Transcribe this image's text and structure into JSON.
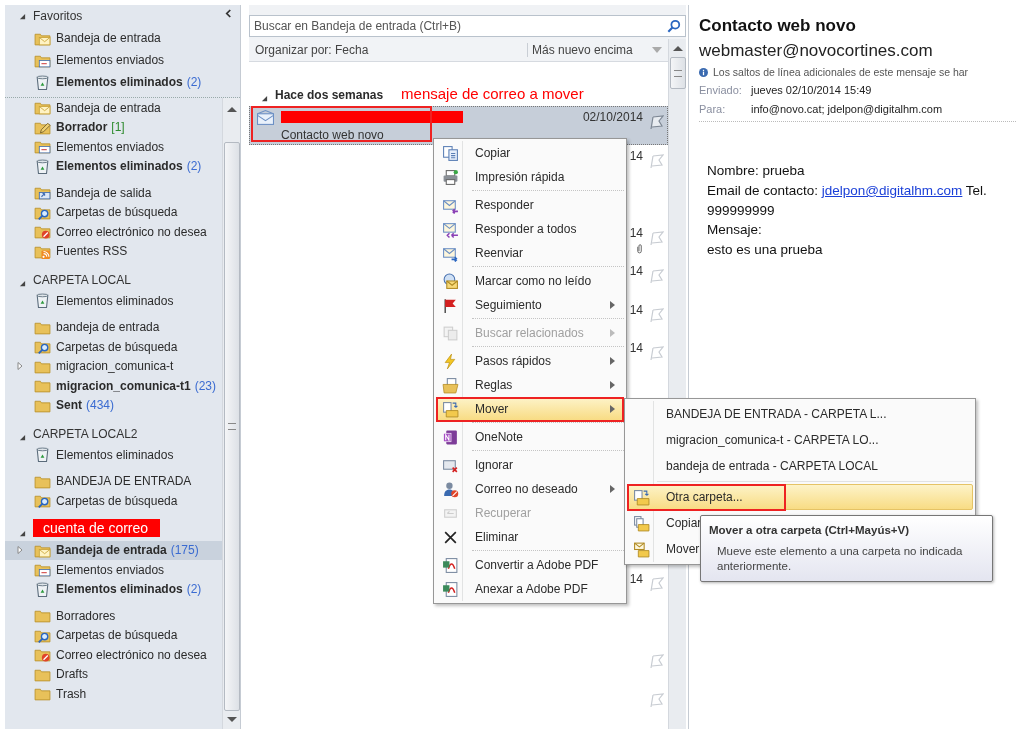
{
  "sidebar": {
    "favorites": {
      "title": "Favoritos",
      "expanded": true,
      "items": [
        {
          "name": "Bandeja de entrada",
          "kind": "inbox",
          "bold": false,
          "selected": false,
          "expandable": false
        },
        {
          "name": "Elementos enviados",
          "kind": "sent",
          "bold": false,
          "selected": false,
          "expandable": false
        },
        {
          "name": "Elementos eliminados",
          "kind": "deleted",
          "bold": true,
          "count": "(2)",
          "selected": false,
          "expandable": false
        }
      ]
    },
    "sections": [
      {
        "items": [
          {
            "name": "Bandeja de entrada",
            "kind": "inbox",
            "bold": false,
            "selected": false,
            "expandable": false
          },
          {
            "name": "Borrador",
            "kind": "drafts",
            "bold": true,
            "count": "[1]",
            "selected": false,
            "expandable": false
          },
          {
            "name": "Elementos enviados",
            "kind": "sent",
            "bold": false,
            "selected": false,
            "expandable": false
          },
          {
            "name": "Elementos eliminados",
            "kind": "deleted",
            "bold": true,
            "count": "(2)",
            "selected": false,
            "expandable": false
          },
          {
            "name": "Bandeja de salida",
            "kind": "outbox",
            "bold": false,
            "selected": false,
            "expandable": false
          },
          {
            "name": "Carpetas de búsqueda",
            "kind": "search",
            "bold": false,
            "selected": false,
            "expandable": false
          },
          {
            "name": "Correo electrónico no desea",
            "kind": "junk",
            "bold": false,
            "selected": false,
            "expandable": false
          },
          {
            "name": "Fuentes RSS",
            "kind": "rss",
            "bold": false,
            "selected": false,
            "expandable": false
          }
        ]
      },
      {
        "header": "CARPETA LOCAL",
        "kind": "plain",
        "expanded": true,
        "items": [
          {
            "name": "Elementos eliminados",
            "kind": "deleted",
            "bold": false,
            "selected": false,
            "expandable": false
          },
          {
            "name": "bandeja de entrada",
            "kind": "folder",
            "bold": false,
            "selected": false,
            "expandable": false
          },
          {
            "name": "Carpetas de búsqueda",
            "kind": "search",
            "bold": false,
            "selected": false,
            "expandable": false
          },
          {
            "name": "migracion_comunica-t",
            "kind": "folder",
            "bold": false,
            "selected": false,
            "expandable": true
          },
          {
            "name": "migracion_comunica-t1",
            "kind": "folder",
            "bold": true,
            "count": "(23)",
            "selected": false,
            "expandable": false
          },
          {
            "name": "Sent",
            "kind": "folder",
            "bold": true,
            "count": "(434)",
            "selected": false,
            "expandable": false
          }
        ]
      },
      {
        "header": "CARPETA LOCAL2",
        "kind": "plain",
        "expanded": true,
        "items": [
          {
            "name": "Elementos eliminados",
            "kind": "deleted",
            "bold": false,
            "selected": false,
            "expandable": false
          },
          {
            "name": "BANDEJA DE ENTRADA",
            "kind": "folder",
            "bold": false,
            "selected": false,
            "expandable": false
          },
          {
            "name": "Carpetas de búsqueda",
            "kind": "search",
            "bold": false,
            "selected": false,
            "expandable": false
          }
        ]
      },
      {
        "header": "cuenta de correo",
        "kind": "annotation",
        "expanded": true,
        "items": [
          {
            "name": "Bandeja de entrada",
            "kind": "inbox",
            "bold": true,
            "count": "(175)",
            "selected": true,
            "expandable": true
          },
          {
            "name": "Elementos enviados",
            "kind": "sent",
            "bold": false,
            "selected": false,
            "expandable": false
          },
          {
            "name": "Elementos eliminados",
            "kind": "deleted",
            "bold": true,
            "count": "(2)",
            "selected": false,
            "expandable": false
          },
          {
            "name": "Borradores",
            "kind": "folder",
            "bold": false,
            "selected": false,
            "expandable": false
          },
          {
            "name": "Carpetas de búsqueda",
            "kind": "search",
            "bold": false,
            "selected": false,
            "expandable": false
          },
          {
            "name": "Correo electrónico no desea",
            "kind": "junk",
            "bold": false,
            "selected": false,
            "expandable": false
          },
          {
            "name": "Drafts",
            "kind": "folder",
            "bold": false,
            "selected": false,
            "expandable": false
          },
          {
            "name": "Trash",
            "kind": "folder",
            "bold": false,
            "selected": false,
            "expandable": false
          }
        ]
      }
    ]
  },
  "search": {
    "placeholder": "Buscar en Bandeja de entrada (Ctrl+B)"
  },
  "arrange": {
    "label": "Organizar por: Fecha",
    "order": "Más nuevo encima"
  },
  "group": {
    "title": "Hace dos semanas",
    "expanded": true,
    "annotation": "mensaje de correo a mover"
  },
  "messages": [
    {
      "kind": "message",
      "subject": "Contacto web novo",
      "date": "02/10/2014",
      "redacted": true,
      "annotated": true,
      "selected": true,
      "attachment": false
    },
    {
      "kind": "message",
      "date": "14",
      "selected": false,
      "attachment": false
    },
    {
      "kind": "blank"
    },
    {
      "kind": "message",
      "date": "14",
      "selected": false,
      "attachment": true
    },
    {
      "kind": "message",
      "date": "14",
      "selected": false,
      "attachment": false
    },
    {
      "kind": "message",
      "date": "14",
      "selected": false,
      "attachment": false
    },
    {
      "kind": "message",
      "date": "14",
      "selected": false,
      "attachment": false
    },
    {
      "kind": "blank"
    },
    {
      "kind": "blank"
    },
    {
      "kind": "blank"
    },
    {
      "kind": "blank"
    },
    {
      "kind": "blank"
    },
    {
      "kind": "message",
      "date": "14",
      "selected": false,
      "attachment": false
    },
    {
      "kind": "blank"
    },
    {
      "kind": "message",
      "selected": false,
      "attachment": false
    },
    {
      "kind": "message",
      "selected": false,
      "attachment": false
    }
  ],
  "context_menu": {
    "groups": [
      [
        {
          "label": "Copiar",
          "kind": "copy",
          "submenu": false,
          "disabled": false,
          "selected": false,
          "annotated": false
        },
        {
          "label": "Impresión rápida",
          "kind": "print",
          "submenu": false,
          "disabled": false,
          "selected": false,
          "annotated": false
        }
      ],
      [
        {
          "label": "Responder",
          "kind": "reply",
          "submenu": false,
          "disabled": false,
          "selected": false,
          "annotated": false
        },
        {
          "label": "Responder a todos",
          "kind": "replyall",
          "submenu": false,
          "disabled": false,
          "selected": false,
          "annotated": false
        },
        {
          "label": "Reenviar",
          "kind": "forward",
          "submenu": false,
          "disabled": false,
          "selected": false,
          "annotated": false
        }
      ],
      [
        {
          "label": "Marcar como no leído",
          "kind": "unread",
          "submenu": false,
          "disabled": false,
          "selected": false,
          "annotated": false
        },
        {
          "label": "Seguimiento",
          "kind": "flag",
          "submenu": true,
          "disabled": false,
          "selected": false,
          "annotated": false
        }
      ],
      [
        {
          "label": "Buscar relacionados",
          "kind": "related",
          "submenu": true,
          "disabled": true,
          "selected": false,
          "annotated": false
        }
      ],
      [
        {
          "label": "Pasos rápidos",
          "kind": "quick",
          "submenu": true,
          "disabled": false,
          "selected": false,
          "annotated": false
        },
        {
          "label": "Reglas",
          "kind": "rules",
          "submenu": true,
          "disabled": false,
          "selected": false,
          "annotated": false
        },
        {
          "label": "Mover",
          "kind": "move",
          "submenu": true,
          "disabled": false,
          "selected": true,
          "annotated": true
        }
      ],
      [
        {
          "label": "OneNote",
          "kind": "onenote",
          "submenu": false,
          "disabled": false,
          "selected": false,
          "annotated": false
        }
      ],
      [
        {
          "label": "Ignorar",
          "kind": "ignore",
          "submenu": false,
          "disabled": false,
          "selected": false,
          "annotated": false
        },
        {
          "label": "Correo no deseado",
          "kind": "junkmail",
          "submenu": true,
          "disabled": false,
          "selected": false,
          "annotated": false
        },
        {
          "label": "Recuperar",
          "kind": "recover",
          "submenu": false,
          "disabled": true,
          "selected": false,
          "annotated": false
        },
        {
          "label": "Eliminar",
          "kind": "delete",
          "submenu": false,
          "disabled": false,
          "selected": false,
          "annotated": false
        }
      ],
      [
        {
          "label": "Convertir a Adobe PDF",
          "kind": "pdf",
          "submenu": false,
          "disabled": false,
          "selected": false,
          "annotated": false
        },
        {
          "label": "Anexar a Adobe PDF",
          "kind": "pdf",
          "submenu": false,
          "disabled": false,
          "selected": false,
          "annotated": false
        }
      ]
    ]
  },
  "move_submenu": {
    "groups": [
      [
        {
          "label": "BANDEJA DE ENTRADA - CARPETA L...",
          "kind": "recent",
          "selected": false,
          "annotated": false
        },
        {
          "label": "migracion_comunica-t - CARPETA LO...",
          "kind": "recent",
          "selected": false,
          "annotated": false
        },
        {
          "label": "bandeja de entrada - CARPETA LOCAL",
          "kind": "recent",
          "selected": false,
          "annotated": false
        }
      ],
      [
        {
          "label": "Otra carpeta...",
          "kind": "move",
          "selected": true,
          "annotated": true
        },
        {
          "label": "Copiar",
          "kind": "copyfolder",
          "selected": false,
          "annotated": false
        },
        {
          "label": "Mover",
          "kind": "movemail",
          "selected": false,
          "annotated": false
        }
      ]
    ]
  },
  "tooltip": {
    "title": "Mover a otra carpeta (Ctrl+Mayús+V)",
    "text": "Mueve este elemento a una carpeta no indicada anteriormente."
  },
  "reading_pane": {
    "subject": "Contacto web novo",
    "sender": "webmaster@novocortines.com",
    "info": "Los saltos de línea adicionales de este mensaje se har",
    "fields": [
      {
        "label": "Enviado:",
        "value": "jueves 02/10/2014 15:49"
      },
      {
        "label": "Para:",
        "value": "info@novo.cat; jdelpon@digitalhm.com"
      }
    ],
    "body": [
      {
        "text": "Nombre: prueba"
      },
      {
        "text": "Email de contacto:",
        "link": "jdelpon@digitalhm.com",
        "after": "Tel."
      },
      {
        "text": "999999999"
      },
      {
        "text": "Mensaje:"
      },
      {
        "text": "esto es una prueba"
      }
    ]
  }
}
